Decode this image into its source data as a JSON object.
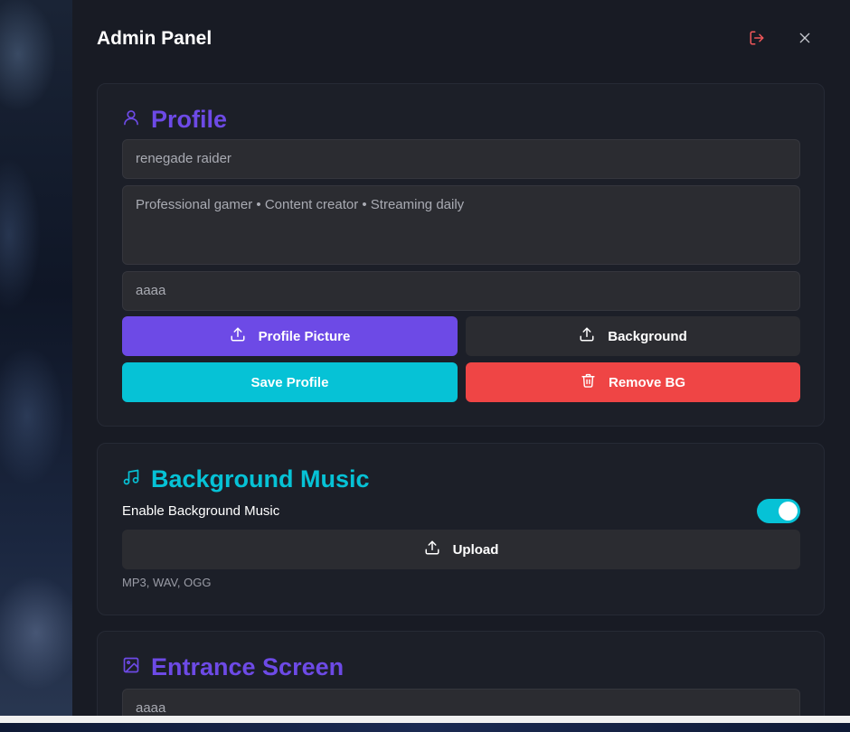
{
  "header": {
    "title": "Admin Panel",
    "logout_icon": "logout-icon",
    "close_icon": "close-icon"
  },
  "profile": {
    "title": "Profile",
    "icon": "user-icon",
    "name_value": "renegade raider",
    "bio_value": "Professional gamer • Content creator • Streaming daily",
    "third_value": "aaaa",
    "profile_picture_label": "Profile Picture",
    "background_label": "Background",
    "save_label": "Save Profile",
    "remove_bg_label": "Remove BG"
  },
  "music": {
    "title": "Background Music",
    "icon": "music-note-icon",
    "enable_label": "Enable Background Music",
    "enabled": true,
    "upload_label": "Upload",
    "formats_hint": "MP3, WAV, OGG"
  },
  "entrance": {
    "title": "Entrance Screen",
    "icon": "image-icon",
    "text_value": "aaaa"
  },
  "colors": {
    "purple": "#6d4ae6",
    "cyan": "#06c2d6",
    "red": "#ef4545",
    "panel": "#181b24",
    "card": "#1c1f28",
    "input": "#2b2c31"
  }
}
